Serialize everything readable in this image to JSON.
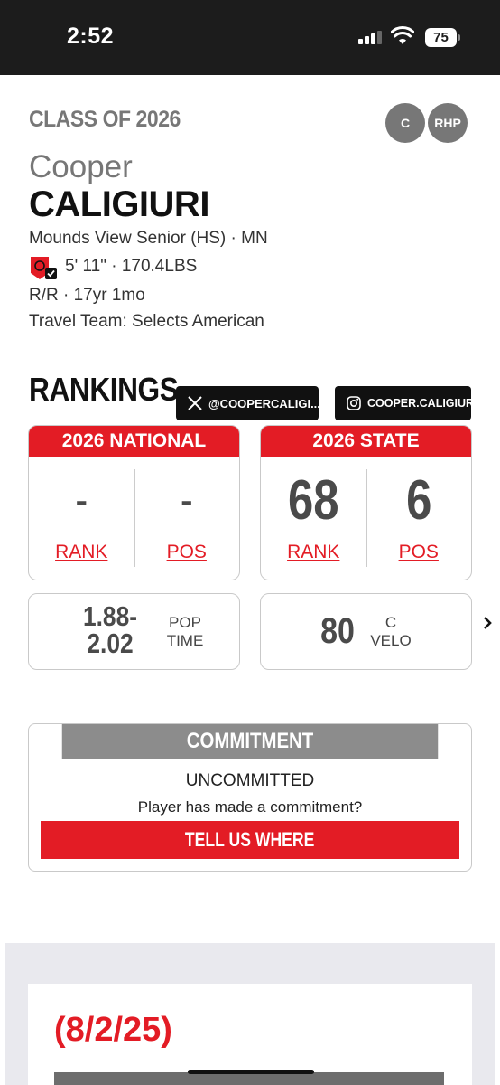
{
  "status_bar": {
    "time": "2:52",
    "battery": "75"
  },
  "profile": {
    "class_of": "CLASS OF 2026",
    "positions": [
      "C",
      "RHP"
    ],
    "first_name": "Cooper",
    "last_name": "CALIGIURI",
    "school": "Mounds View Senior (HS) · MN",
    "height_weight": "5' 11\" · 170.4LBS",
    "bats_throws_age": "R/R · 17yr 1mo",
    "travel_team": "Travel Team: Selects American"
  },
  "rankings": {
    "title": "RANKINGS",
    "social": {
      "x_handle": "@COOPERCALIGI...",
      "instagram_handle": "COOPER.CALIGIURI"
    },
    "national": {
      "header": "2026 NATIONAL",
      "rank": "-",
      "pos": "-",
      "rank_label": "RANK",
      "pos_label": "POS"
    },
    "state": {
      "header": "2026 STATE",
      "rank": "68",
      "pos": "6",
      "rank_label": "RANK",
      "pos_label": "POS"
    },
    "pop_time": {
      "value_line1": "1.88-",
      "value_line2": "2.02",
      "label_line1": "POP",
      "label_line2": "TIME"
    },
    "c_velo": {
      "value": "80",
      "label_line1": "C",
      "label_line2": "VELO"
    }
  },
  "commitment": {
    "header": "COMMITMENT",
    "status": "UNCOMMITTED",
    "question": "Player has made a commitment?",
    "button": "TELL US WHERE"
  },
  "news": {
    "date": "(8/2/25)"
  },
  "colors": {
    "accent": "#e31c25",
    "badge": "#777777"
  }
}
